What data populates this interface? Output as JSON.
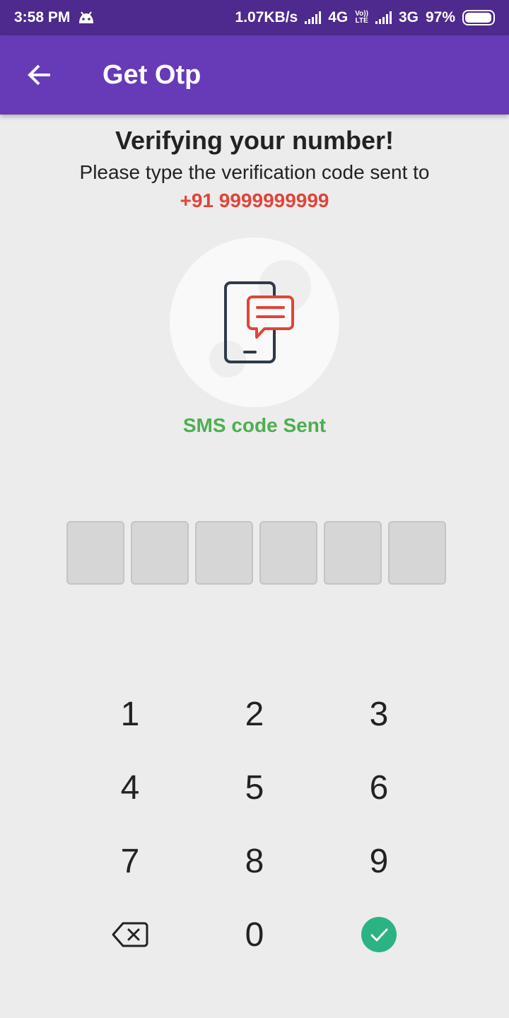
{
  "status_bar": {
    "time": "3:58 PM",
    "network_speed": "1.07KB/s",
    "network_1": "4G",
    "volte_top": "Vo))",
    "volte_bottom": "LTE",
    "network_2": "3G",
    "battery": "97%",
    "icons": [
      "android-icon",
      "signal-icon",
      "signal-icon",
      "battery-icon"
    ]
  },
  "app_bar": {
    "title": "Get Otp",
    "back_icon": "arrow-left-icon"
  },
  "content": {
    "heading": "Verifying your number!",
    "subtitle": "Please type the verification code sent to",
    "phone_number": "+91 9999999999",
    "status": "SMS code Sent",
    "illustration_icon": "phone-message-icon"
  },
  "otp": {
    "length": 6,
    "values": [
      "",
      "",
      "",
      "",
      "",
      ""
    ]
  },
  "keypad": {
    "keys": [
      "1",
      "2",
      "3",
      "4",
      "5",
      "6",
      "7",
      "8",
      "9",
      "0"
    ],
    "backspace_icon": "backspace-icon",
    "confirm_icon": "check-icon"
  },
  "colors": {
    "status_bar": "#4e2a8e",
    "app_bar": "#673ab7",
    "phone_number": "#e0443a",
    "sms_status": "#4caf50",
    "confirm": "#2bb383",
    "background": "#ececec"
  }
}
